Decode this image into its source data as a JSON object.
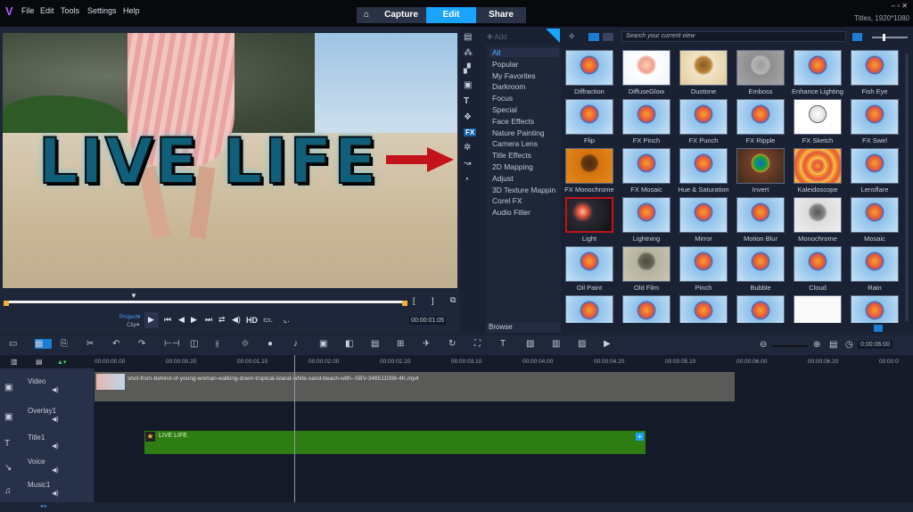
{
  "menubar": {
    "items": [
      "File",
      "Edit",
      "Tools",
      "Settings",
      "Help"
    ],
    "tabs": [
      {
        "label": "Capture"
      },
      {
        "label": "Edit",
        "active": true
      },
      {
        "label": "Share"
      }
    ],
    "home_icon": "home-icon",
    "status": "Titles, 1920*1080"
  },
  "preview": {
    "title_text": "LIVE LIFE",
    "arrow_color": "#c4121a"
  },
  "player": {
    "project_label": "Project▾",
    "clip_label": "Clip▾",
    "hd_label": "HD",
    "timecode": "00:00:01:05"
  },
  "library": {
    "add_label": "Add",
    "search_placeholder": "Search your current view",
    "browse_label": "Browse",
    "categories": [
      "All",
      "Popular",
      "My Favorites",
      "Darkroom",
      "Focus",
      "Special",
      "Face Effects",
      "Nature Painting",
      "Camera Lens",
      "Title Effects",
      "2D Mapping",
      "Adjust",
      "3D Texture Mappin",
      "Corel FX",
      "Audio Filter"
    ],
    "selected_category": "All",
    "selected_panel": "FX",
    "effects": [
      {
        "name": "Diffraction",
        "style": "balloon"
      },
      {
        "name": "DiffuseGlow",
        "style": "glow"
      },
      {
        "name": "Duotone",
        "style": "sepia"
      },
      {
        "name": "Emboss",
        "style": "emboss"
      },
      {
        "name": "Enhance Lighting",
        "style": "balloon"
      },
      {
        "name": "Fish Eye",
        "style": "balloon"
      },
      {
        "name": "Flip",
        "style": "balloon"
      },
      {
        "name": "FX Pinch",
        "style": "balloon"
      },
      {
        "name": "FX Punch",
        "style": "balloon"
      },
      {
        "name": "FX Ripple",
        "style": "balloon"
      },
      {
        "name": "FX Sketch",
        "style": "sketch"
      },
      {
        "name": "FX Swirl",
        "style": "balloon"
      },
      {
        "name": "FX Monochrome",
        "style": "orange"
      },
      {
        "name": "FX Mosaic",
        "style": "balloon"
      },
      {
        "name": "Hue & Saturation",
        "style": "balloon"
      },
      {
        "name": "Invert",
        "style": "invert"
      },
      {
        "name": "Kaleidoscope",
        "style": "kaleido"
      },
      {
        "name": "Lensflare",
        "style": "balloon"
      },
      {
        "name": "Light",
        "style": "light",
        "selected": true
      },
      {
        "name": "Lightning",
        "style": "balloon"
      },
      {
        "name": "Mirror",
        "style": "balloon"
      },
      {
        "name": "Motion Blur",
        "style": "balloon"
      },
      {
        "name": "Monochrome",
        "style": "gray"
      },
      {
        "name": "Mosaic",
        "style": "balloon"
      },
      {
        "name": "Oil Paint",
        "style": "balloon"
      },
      {
        "name": "Old Film",
        "style": "oldfilm"
      },
      {
        "name": "Pinch",
        "style": "balloon"
      },
      {
        "name": "Bubble",
        "style": "balloon"
      },
      {
        "name": "Cloud",
        "style": "balloon"
      },
      {
        "name": "Rain",
        "style": "balloon"
      },
      {
        "name": "",
        "style": "balloon"
      },
      {
        "name": "",
        "style": "balloon"
      },
      {
        "name": "",
        "style": "balloon"
      },
      {
        "name": "",
        "style": "balloon"
      },
      {
        "name": "",
        "style": "white"
      },
      {
        "name": "",
        "style": "balloon"
      }
    ]
  },
  "timeline": {
    "timecode": "0:00:06:00",
    "ruler": [
      "00:00:00.00",
      "00:00:00.20",
      "00:00:01.10",
      "00:00:02.00",
      "00:00:02.20",
      "00:00:03.10",
      "00:00:04.00",
      "00:00:04.20",
      "00:00:05.10",
      "00:00:06.00",
      "00:00:06.20",
      "00:00:0"
    ],
    "tracks": [
      "Video",
      "Overlay1",
      "Title1",
      "Voice",
      "Music1"
    ],
    "video_clip": "shot-from-behind-of-young-woman-walking-down-tropical-island-white-sand-beach-with--SBV-346511008-4K.mp4",
    "title_clip": "LIVE LIFE"
  },
  "colors": {
    "accent": "#1aa3ff",
    "title_clip": "#2e7d12",
    "video_clip": "#5a5a58",
    "selection": "#c4121a"
  }
}
